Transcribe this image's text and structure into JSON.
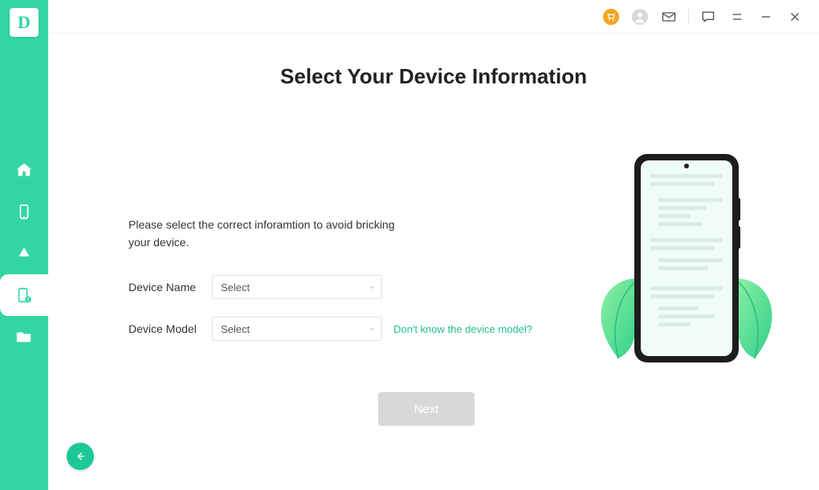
{
  "app": {
    "logo_letter": "D"
  },
  "page": {
    "title": "Select Your Device Information",
    "hint": "Please select the correct inforamtion to avoid bricking your device."
  },
  "form": {
    "device_name_label": "Device Name",
    "device_name_value": "Select",
    "device_model_label": "Device Model",
    "device_model_value": "Select",
    "model_help_link": "Don't know the device model?",
    "next_label": "Next"
  },
  "titlebar": {
    "cart_icon": "cart",
    "user_icon": "user",
    "mail_icon": "mail",
    "feedback_icon": "feedback",
    "menu_icon": "menu",
    "minimize_icon": "minimize",
    "close_icon": "close"
  },
  "sidebar": {
    "items": [
      {
        "name": "home"
      },
      {
        "name": "phone"
      },
      {
        "name": "cloud"
      },
      {
        "name": "phone-alert"
      },
      {
        "name": "folder"
      }
    ]
  },
  "colors": {
    "accent": "#33d6a3",
    "warn": "#f5a623",
    "disabled": "#d8d8d8",
    "link": "#22c08f"
  }
}
